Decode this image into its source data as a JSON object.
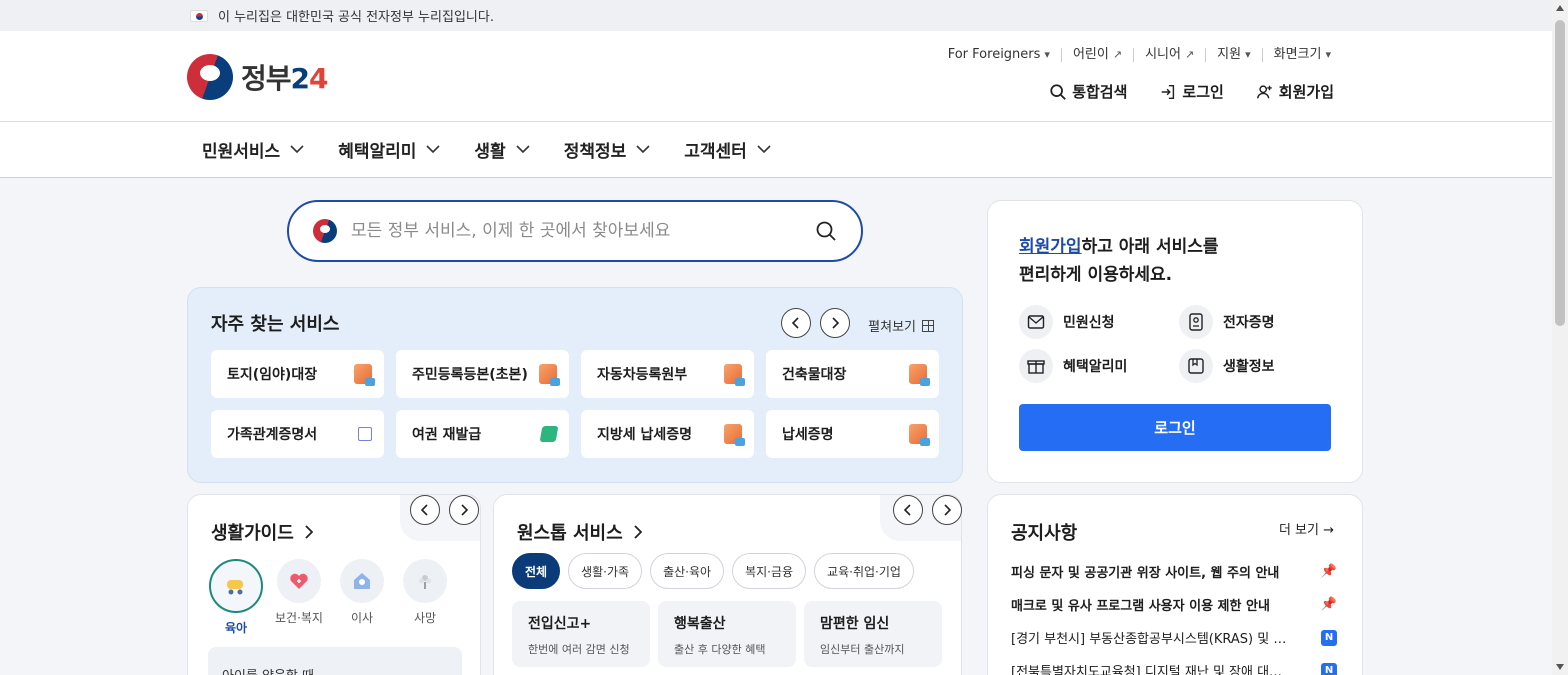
{
  "banner": {
    "text": "이 누리집은 대한민국 공식 전자정부 누리집입니다."
  },
  "logo": {
    "word": "정부",
    "num": "2",
    "plus": "4"
  },
  "util": [
    {
      "label": "For Foreigners",
      "suffix": "▾"
    },
    {
      "label": "어린이",
      "suffix": "↗"
    },
    {
      "label": "시니어",
      "suffix": "↗"
    },
    {
      "label": "지원",
      "suffix": "▾"
    },
    {
      "label": "화면크기",
      "suffix": "▾"
    }
  ],
  "account": {
    "search": "통합검색",
    "login": "로그인",
    "signup": "회원가입"
  },
  "gnb": [
    "민원서비스",
    "혜택알리미",
    "생활",
    "정책정보",
    "고객센터"
  ],
  "search": {
    "placeholder": "모든 정부 서비스, 이제 한 곳에서 찾아보세요"
  },
  "frequent": {
    "title": "자주 찾는 서비스",
    "expand": "펼쳐보기",
    "items": [
      {
        "label": "토지(임야)대장",
        "icon": "document-icon"
      },
      {
        "label": "주민등록등본(초본)",
        "icon": "document-icon"
      },
      {
        "label": "자동차등록원부",
        "icon": "document-icon"
      },
      {
        "label": "건축물대장",
        "icon": "document-icon"
      },
      {
        "label": "가족관계증명서",
        "icon": "external-link-icon"
      },
      {
        "label": "여권 재발급",
        "icon": "edit-icon"
      },
      {
        "label": "지방세 납세증명",
        "icon": "document-icon"
      },
      {
        "label": "납세증명",
        "icon": "document-icon"
      }
    ]
  },
  "life": {
    "title": "생활가이드",
    "categories": [
      {
        "label": "육아",
        "active": true
      },
      {
        "label": "보건·복지",
        "active": false
      },
      {
        "label": "이사",
        "active": false
      },
      {
        "label": "사망",
        "active": false
      }
    ],
    "sub_item": "아이를 양육할 때"
  },
  "onestop": {
    "title": "원스톱 서비스",
    "chips": [
      "전체",
      "생활·가족",
      "출산·육아",
      "복지·금융",
      "교육·취업·기업"
    ],
    "cards": [
      {
        "title": "전입신고+",
        "desc": "한번에 여러 감면 신청"
      },
      {
        "title": "행복출산",
        "desc": "출산 후 다양한 혜택"
      },
      {
        "title": "맘편한 임신",
        "desc": "임신부터 출산까지"
      }
    ]
  },
  "join": {
    "link": "회원가입",
    "line1_rest": "하고 아래 서비스를",
    "line2": "편리하게 이용하세요.",
    "items": [
      "민원신청",
      "전자증명",
      "혜택알리미",
      "생활정보"
    ],
    "login_button": "로그인"
  },
  "notices": {
    "title": "공지사항",
    "more": "더 보기 →",
    "items": [
      {
        "text": "피싱 문자 및 공공기관 위장 사이트, 웹 주의 안내",
        "pinned": true,
        "badge": ""
      },
      {
        "text": "매크로 및 유사 프로그램 사용자 이용 제한 안내",
        "pinned": true,
        "badge": ""
      },
      {
        "text": "[경기 부천시] 부동산종합공부시스템(KRAS) 및 …",
        "pinned": false,
        "badge": "N"
      },
      {
        "text": "[전북특별자치도교육청] 디지털 재난 및 장애 대…",
        "pinned": false,
        "badge": "N"
      }
    ]
  }
}
